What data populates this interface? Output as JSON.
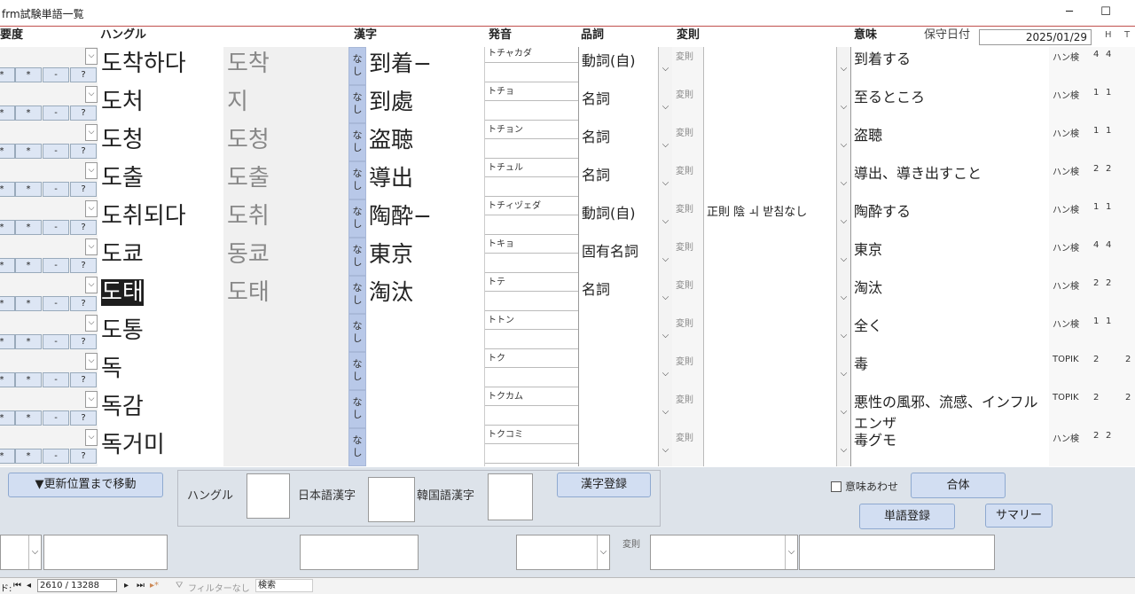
{
  "window": {
    "title": "frm試験単語一覧",
    "minimize": "─",
    "maximize": "☐"
  },
  "header": {
    "importance": "要度",
    "hangul": "ハングル",
    "kanji": "漢字",
    "pron": "発音",
    "pos": "品詞",
    "inflect": "変則",
    "meaning": "意味",
    "saved_date_label": "保守日付",
    "saved_date": "2025/01/29",
    "h": "H",
    "t": "T"
  },
  "row_buttons": [
    "*",
    "*",
    "-",
    "?"
  ],
  "rows": [
    {
      "hangul": "도착하다",
      "hangul2": "도착",
      "nashi": "なし",
      "kanji": "到着−",
      "pron": "トチャカダ",
      "pos": "動詞(自)",
      "inflect_label": "変則",
      "inflect": "",
      "meaning": "到着する",
      "src": "ハン検",
      "h": "4",
      "t": "4",
      "x": ""
    },
    {
      "hangul": "도처",
      "hangul2": "지",
      "nashi": "なし",
      "kanji": "到處",
      "pron": "トチョ",
      "pos": "名詞",
      "inflect_label": "変則",
      "inflect": "",
      "meaning": "至るところ",
      "src": "ハン検",
      "h": "1",
      "t": "1",
      "x": ""
    },
    {
      "hangul": "도청",
      "hangul2": "도청",
      "nashi": "なし",
      "kanji": "盗聴",
      "pron": "トチョン",
      "pos": "名詞",
      "inflect_label": "変則",
      "inflect": "",
      "meaning": "盗聴",
      "src": "ハン検",
      "h": "1",
      "t": "1",
      "x": ""
    },
    {
      "hangul": "도출",
      "hangul2": "도출",
      "nashi": "なし",
      "kanji": "導出",
      "pron": "トチュル",
      "pos": "名詞",
      "inflect_label": "変則",
      "inflect": "",
      "meaning": "導出、導き出すこと",
      "src": "ハン検",
      "h": "2",
      "t": "2",
      "x": ""
    },
    {
      "hangul": "도취되다",
      "hangul2": "도취",
      "nashi": "なし",
      "kanji": "陶酔−",
      "pron": "トチィヅェダ",
      "pos": "動詞(自)",
      "inflect_label": "変則",
      "inflect": "正則 陰 ㅚ 받침なし",
      "meaning": "陶酔する",
      "src": "ハン検",
      "h": "1",
      "t": "1",
      "x": ""
    },
    {
      "hangul": "도쿄",
      "hangul2": "동쿄",
      "nashi": "なし",
      "kanji": "東京",
      "pron": "トキョ",
      "pos": "固有名詞",
      "inflect_label": "変則",
      "inflect": "",
      "meaning": "東京",
      "src": "ハン検",
      "h": "4",
      "t": "4",
      "x": ""
    },
    {
      "hangul": "도태",
      "hangul2": "도태",
      "nashi": "なし",
      "kanji": "淘汰",
      "pron": "トテ",
      "pos": "名詞",
      "inflect_label": "変則",
      "inflect": "",
      "meaning": "淘汰",
      "src": "ハン検",
      "h": "2",
      "t": "2",
      "x": ""
    },
    {
      "hangul": "도통",
      "hangul2": "",
      "nashi": "なし",
      "kanji": "",
      "pron": "トトン",
      "pos": "",
      "inflect_label": "変則",
      "inflect": "",
      "meaning": "全く",
      "src": "ハン検",
      "h": "1",
      "t": "1",
      "x": ""
    },
    {
      "hangul": "독",
      "hangul2": "",
      "nashi": "なし",
      "kanji": "",
      "pron": "トク",
      "pos": "",
      "inflect_label": "変則",
      "inflect": "",
      "meaning": "毒",
      "src": "TOPIK",
      "h": "2",
      "t": "",
      "x": "2"
    },
    {
      "hangul": "독감",
      "hangul2": "",
      "nashi": "なし",
      "kanji": "",
      "pron": "トクカム",
      "pos": "",
      "inflect_label": "変則",
      "inflect": "",
      "meaning": "悪性の風邪、流感、インフルエンザ",
      "src": "TOPIK",
      "h": "2",
      "t": "",
      "x": "2"
    },
    {
      "hangul": "독거미",
      "hangul2": "",
      "nashi": "なし",
      "kanji": "",
      "pron": "トクコミ",
      "pos": "",
      "inflect_label": "変則",
      "inflect": "",
      "meaning": "毒グモ",
      "src": "ハン検",
      "h": "2",
      "t": "2",
      "x": ""
    }
  ],
  "bottom": {
    "move_button": "▼更新位置まで移動",
    "hangul_label": "ハングル",
    "jp_kanji_label": "日本語漢字",
    "kr_kanji_label": "韓国語漢字",
    "kanji_register": "漢字登録",
    "meaning_match": "意味あわせ",
    "merge": "合体",
    "word_register": "単語登録",
    "summary": "サマリー",
    "inflect_label": "変則"
  },
  "nav": {
    "record_label": "ド:",
    "position": "2610 / 13288",
    "filter": "フィルターなし",
    "search": "検索"
  }
}
